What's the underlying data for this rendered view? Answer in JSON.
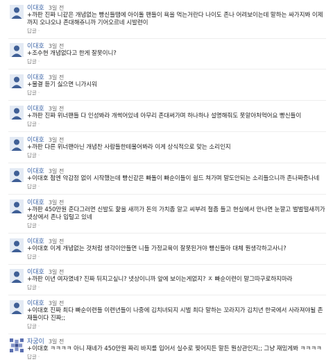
{
  "comments": [
    {
      "author": "이대호",
      "time": "3일 전",
      "text": "+까판 진짜 니같은 개념없는 빵신들땜에 아이돌 팬들이 욕을 먹는거란다 나이도 존나 어려보이는데 말하는 싸가지봐 이제까지 오냐오냐 존대해쥬니까 기어오르네 시발련이",
      "reply": "답글",
      "avatar_icon": "user-avatar-icon"
    },
    {
      "author": "이대호",
      "time": "3일 전",
      "text": "+조수현 개념없다고 한게 잘못이니?",
      "reply": "답글",
      "avatar_icon": "user-avatar-icon"
    },
    {
      "author": "이대호",
      "time": "3일 전",
      "text": "+물결 듣기 싫으면 니가시워",
      "reply": "답글",
      "avatar_icon": "user-avatar-icon"
    },
    {
      "author": "이대호",
      "time": "3일 전",
      "text": "+까판 진짜 위너팬들 다 인성봐라 개썩어있네 아무리 존대써가며 하나하나 설명해줘도 못알아처먹어요 빵신들이",
      "reply": "답글",
      "avatar_icon": "user-avatar-icon"
    },
    {
      "author": "이대호",
      "time": "3일 전",
      "text": "+까판 다른 위너팬아닌 개념찬 사람들한테물어봐라 이게 상식적으로 맞는 소리인지",
      "reply": "답글",
      "avatar_icon": "user-avatar-icon"
    },
    {
      "author": "이대호",
      "time": "3일 전",
      "text": "+이대호 첨엔 악감정 없이 시작했는데 빵신같은 빠돌이 빠순이들이 쉴드 쳐가며 말도안되는 소리들으니까 존나짜증나네",
      "reply": "답글",
      "avatar_icon": "user-avatar-icon"
    },
    {
      "author": "이대호",
      "time": "3일 전",
      "text": "+까판 450만원 준다그러면 신발도 핥을 새끼가 돈의 가치좀 알고 씨부려 철좀 들고 현실에서 만나면 눈깔고 벌벌떨새끼가 넷상에서 존나 입털고 있네",
      "reply": "답글",
      "avatar_icon": "user-avatar-icon"
    },
    {
      "author": "이대호",
      "time": "3일 전",
      "text": "+이대호 이게 개념없는 것처럼 생각이안들면 니들 가정교육이 잘못된거야 빵신들아 대체 뭔생각하고사니?",
      "reply": "답글",
      "avatar_icon": "user-avatar-icon"
    },
    {
      "author": "이대호",
      "time": "3일 전",
      "text": "+까판 이년 여자였네? 진짜 뒤지고싶니? 넷상이니까 앞에 보이는게없지? ㅈ 빠순이련이 말그따구로하지마라",
      "reply": "답글",
      "avatar_icon": "user-avatar-icon"
    },
    {
      "author": "이대호",
      "time": "3일 전",
      "text": "+이대호 진짜 최다 빠순이련들 이련년들이 나중에 김치녀되지 시벌 최다 말하는 꼬라지가 김치년 한국에서 사라져야될 존재들이다 진짜;;",
      "reply": "답글",
      "avatar_icon": "user-avatar-icon"
    },
    {
      "author": "자굼이",
      "time": "3일 전",
      "text": "+이대호 ㅋㅋㅋㅋ 아니 재네가 450만원 짜리 바지를 입어서 실수로 찢어지든 말든 뭔상관인지;; 그냥 재밌게봐 ㅋㅋㅋㅋ",
      "reply": "답글",
      "avatar_icon": "pattern-avatar-icon"
    }
  ]
}
